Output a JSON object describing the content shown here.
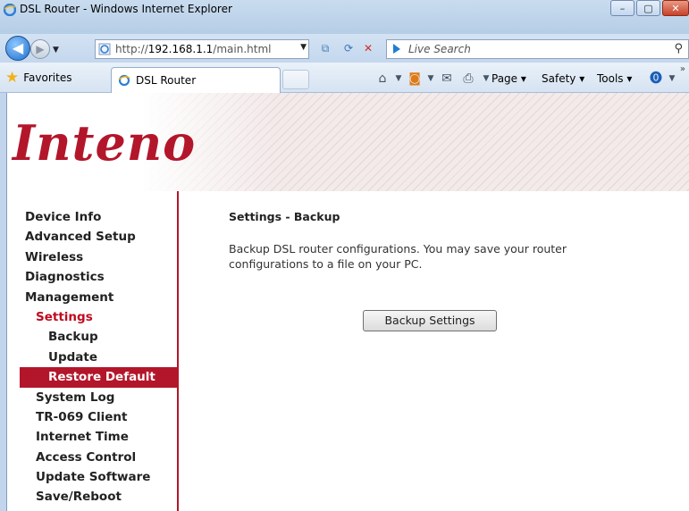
{
  "window": {
    "title": "DSL Router - Windows Internet Explorer",
    "minimize_glyph": "–",
    "maximize_glyph": "▢",
    "close_glyph": "✕"
  },
  "addressbar": {
    "url_prefix": "http://",
    "url_host": "192.168.1.1",
    "url_path": "/main.html",
    "search_placeholder": "Live Search"
  },
  "favorites": {
    "label": "Favorites",
    "tab_title": "DSL Router"
  },
  "commandbar": {
    "page_label": "Page ▾",
    "safety_label": "Safety ▾",
    "tools_label": "Tools ▾"
  },
  "brand": {
    "logo_text": "Inteno",
    "accent_color": "#b3162a"
  },
  "sidebar": {
    "items": [
      {
        "label": "Device Info",
        "level": 0
      },
      {
        "label": "Advanced Setup",
        "level": 0
      },
      {
        "label": "Wireless",
        "level": 0
      },
      {
        "label": "Diagnostics",
        "level": 0
      },
      {
        "label": "Management",
        "level": 0
      },
      {
        "label": "Settings",
        "level": 1,
        "active": true
      },
      {
        "label": "Backup",
        "level": 2
      },
      {
        "label": "Update",
        "level": 2
      },
      {
        "label": "Restore Default",
        "level": 2,
        "selected": true
      },
      {
        "label": "System Log",
        "level": 1
      },
      {
        "label": "TR-069 Client",
        "level": 1
      },
      {
        "label": "Internet Time",
        "level": 1
      },
      {
        "label": "Access Control",
        "level": 1
      },
      {
        "label": "Update Software",
        "level": 1
      },
      {
        "label": "Save/Reboot",
        "level": 1
      }
    ]
  },
  "main": {
    "heading": "Settings - Backup",
    "description_line1": "Backup DSL router configurations. You may save your router",
    "description_line2": "configurations to a file on your PC.",
    "backup_button": "Backup Settings"
  }
}
